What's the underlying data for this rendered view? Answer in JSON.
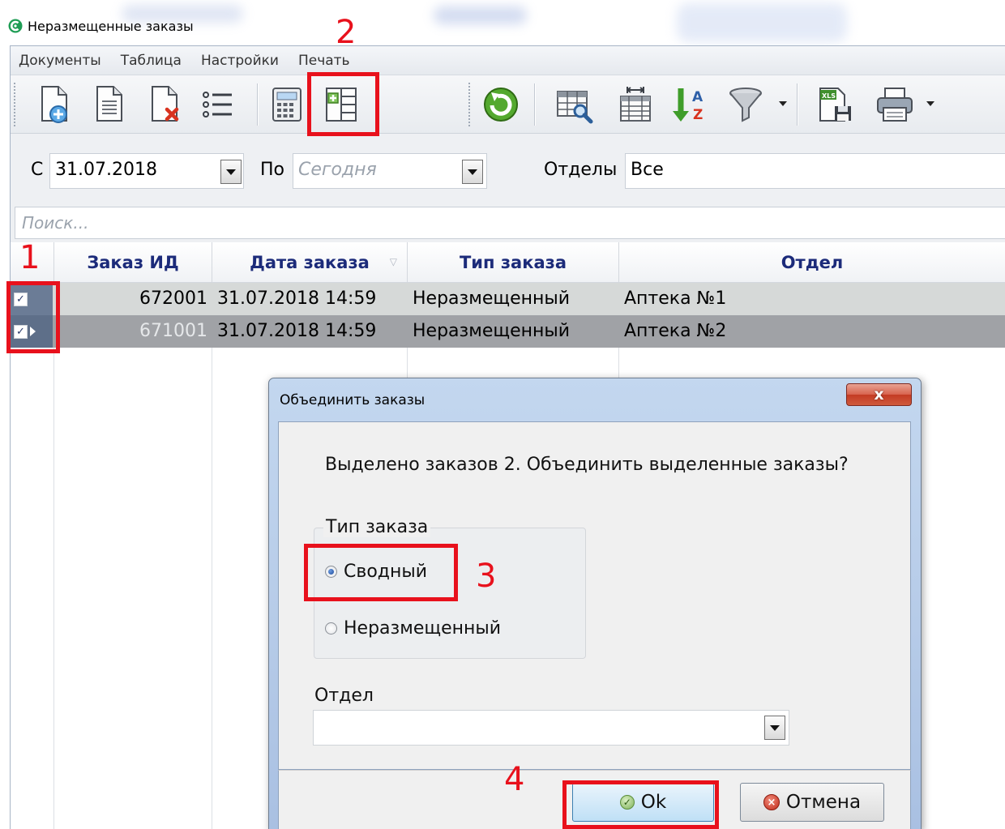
{
  "window": {
    "title": "Неразмещенные заказы"
  },
  "menu": [
    "Документы",
    "Таблица",
    "Настройки",
    "Печать"
  ],
  "toolbar": {
    "icons": [
      "new-document-icon",
      "document-icon",
      "delete-document-icon",
      "list-icon",
      "calculator-icon",
      "merge-orders-icon",
      "refresh-icon",
      "table-search-icon",
      "column-width-icon",
      "sort-az-icon",
      "filter-icon",
      "export-xls-icon",
      "print-icon"
    ],
    "xls_label": "XLS"
  },
  "filters": {
    "from_label": "С",
    "from_value": "31.07.2018",
    "to_label": "По",
    "to_placeholder": "Сегодня",
    "dept_label": "Отделы",
    "dept_value": "Все"
  },
  "search": {
    "placeholder": "Поиск..."
  },
  "grid": {
    "columns": [
      "Заказ ИД",
      "Дата заказа",
      "Тип заказа",
      "Отдел"
    ],
    "rows": [
      {
        "checked": true,
        "id": "672001",
        "date": "31.07.2018 14:59",
        "type": "Неразмещенный",
        "dept": "Аптека №1"
      },
      {
        "checked": true,
        "id": "671001",
        "date": "31.07.2018 14:59",
        "type": "Неразмещенный",
        "dept": "Аптека №2"
      }
    ]
  },
  "dialog": {
    "title": "Объединить заказы",
    "close_label": "x",
    "message": "Выделено заказов 2. Объединить выделенные заказы?",
    "group_label": "Тип заказа",
    "options": [
      {
        "label": "Сводный",
        "selected": true
      },
      {
        "label": "Неразмещенный",
        "selected": false
      }
    ],
    "dept_label": "Отдел",
    "dept_value": "",
    "ok_label": "Ok",
    "cancel_label": "Отмена"
  },
  "annotations": [
    "1",
    "2",
    "3",
    "4"
  ],
  "colors": {
    "annotation": "#e8111c",
    "header_text": "#1c2b7a",
    "selected_row": "#a0a2a6",
    "row_highlight": "#d6d9d8",
    "dialog_frame": "#b6cbe8"
  }
}
